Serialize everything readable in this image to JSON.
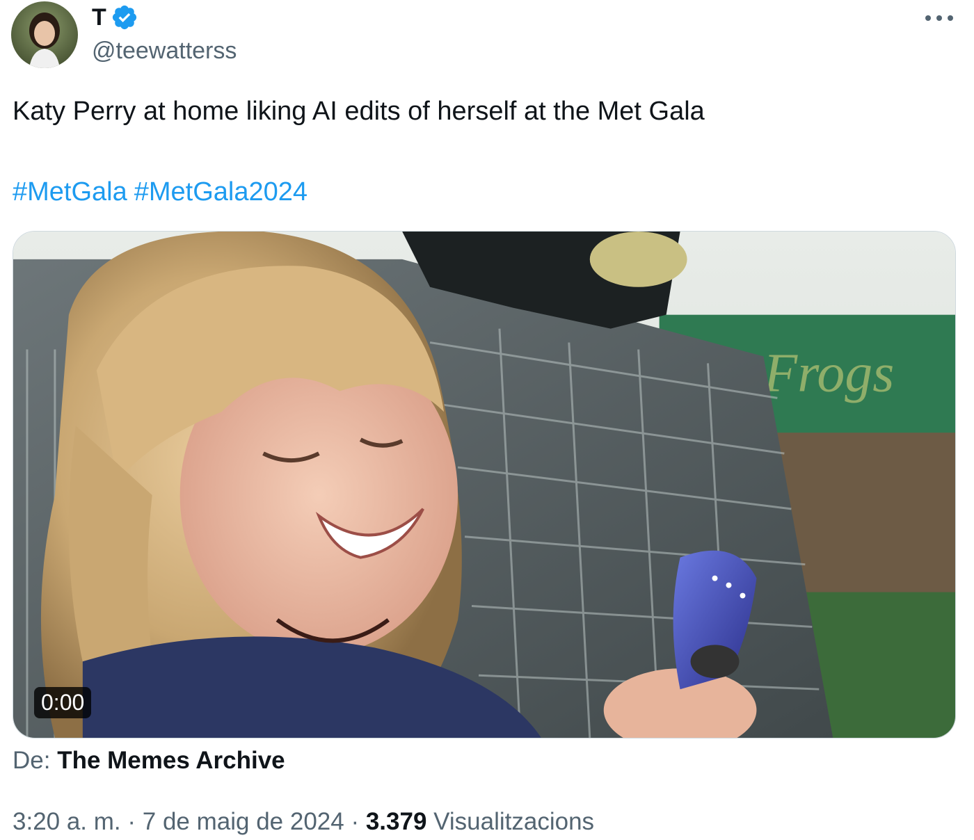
{
  "author": {
    "display_name": "T",
    "handle": "@teewatterss"
  },
  "tweet": {
    "text": "Katy Perry at home liking AI edits of herself at the Met Gala",
    "hashtags": [
      "#MetGala",
      "#MetGala2024"
    ]
  },
  "media": {
    "timestamp": "0:00",
    "sign_text": "Frogs",
    "source_prefix": "De:",
    "source_name": "The Memes Archive"
  },
  "meta": {
    "time": "3:20 a. m.",
    "sep1": "·",
    "date": "7 de maig de 2024",
    "sep2": "·",
    "views_count": "3.379",
    "views_label": "Visualitzacions"
  },
  "colors": {
    "accent": "#1d9bf0",
    "text_primary": "#0f1419",
    "text_secondary": "#536471"
  },
  "icons": [
    "verified-badge-icon",
    "more-options-icon"
  ]
}
